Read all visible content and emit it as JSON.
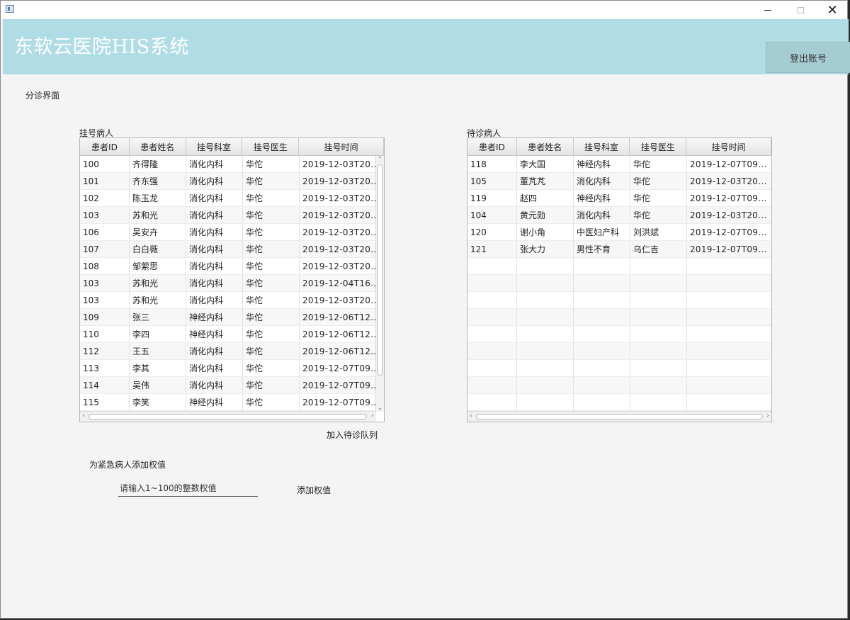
{
  "window": {
    "controls": {
      "minimize": "minimize",
      "maximize": "maximize",
      "close": "close"
    }
  },
  "header": {
    "title": "东软云医院HIS系统",
    "logout_label": "登出账号",
    "bg_color": "#b0dde5"
  },
  "page": {
    "title": "分诊界面"
  },
  "registered": {
    "label": "挂号病人",
    "columns": [
      "患者ID",
      "患者姓名",
      "挂号科室",
      "挂号医生",
      "挂号时间"
    ],
    "rows": [
      [
        "100",
        "齐得隆",
        "消化内科",
        "华佗",
        "2019-12-03T20..."
      ],
      [
        "101",
        "齐东强",
        "消化内科",
        "华佗",
        "2019-12-03T20..."
      ],
      [
        "102",
        "陈玉龙",
        "消化内科",
        "华佗",
        "2019-12-03T20..."
      ],
      [
        "103",
        "苏和光",
        "消化内科",
        "华佗",
        "2019-12-03T20..."
      ],
      [
        "106",
        "吴安卉",
        "消化内科",
        "华佗",
        "2019-12-03T20..."
      ],
      [
        "107",
        "白白薇",
        "消化内科",
        "华佗",
        "2019-12-03T20..."
      ],
      [
        "108",
        "邹萦思",
        "消化内科",
        "华佗",
        "2019-12-03T20..."
      ],
      [
        "103",
        "苏和光",
        "消化内科",
        "华佗",
        "2019-12-04T16..."
      ],
      [
        "103",
        "苏和光",
        "消化内科",
        "华佗",
        "2019-12-03T20..."
      ],
      [
        "109",
        "张三",
        "神经内科",
        "华佗",
        "2019-12-06T12..."
      ],
      [
        "110",
        "李四",
        "神经内科",
        "华佗",
        "2019-12-06T12..."
      ],
      [
        "112",
        "王五",
        "消化内科",
        "华佗",
        "2019-12-06T12..."
      ],
      [
        "113",
        "李其",
        "消化内科",
        "华佗",
        "2019-12-07T09..."
      ],
      [
        "114",
        "吴伟",
        "消化内科",
        "华佗",
        "2019-12-07T09..."
      ],
      [
        "115",
        "李笑",
        "神经内科",
        "华佗",
        "2019-12-07T09..."
      ]
    ],
    "add_button_label": "加入待诊队列"
  },
  "waiting": {
    "label": "待诊病人",
    "columns": [
      "患者ID",
      "患者姓名",
      "挂号科室",
      "挂号医生",
      "挂号时间"
    ],
    "rows": [
      [
        "118",
        "李大国",
        "神经内科",
        "华佗",
        "2019-12-07T09..."
      ],
      [
        "105",
        "董芃芃",
        "消化内科",
        "华佗",
        "2019-12-03T20..."
      ],
      [
        "119",
        "赵四",
        "神经内科",
        "华佗",
        "2019-12-07T09..."
      ],
      [
        "104",
        "黄元勋",
        "消化内科",
        "华佗",
        "2019-12-03T20..."
      ],
      [
        "120",
        "谢小角",
        "中医妇产科",
        "刘洪斌",
        "2019-12-07T09..."
      ],
      [
        "121",
        "张大力",
        "男性不育",
        "乌仁吉",
        "2019-12-07T09..."
      ],
      [
        "",
        "",
        "",
        "",
        ""
      ],
      [
        "",
        "",
        "",
        "",
        ""
      ],
      [
        "",
        "",
        "",
        "",
        ""
      ],
      [
        "",
        "",
        "",
        "",
        ""
      ],
      [
        "",
        "",
        "",
        "",
        ""
      ],
      [
        "",
        "",
        "",
        "",
        ""
      ],
      [
        "",
        "",
        "",
        "",
        ""
      ],
      [
        "",
        "",
        "",
        "",
        ""
      ],
      [
        "",
        "",
        "",
        "",
        ""
      ]
    ]
  },
  "emergency": {
    "label": "为紧急病人添加权值",
    "input_placeholder": "请输入1~100的整数权值",
    "input_value": "",
    "add_weight_label": "添加权值"
  }
}
